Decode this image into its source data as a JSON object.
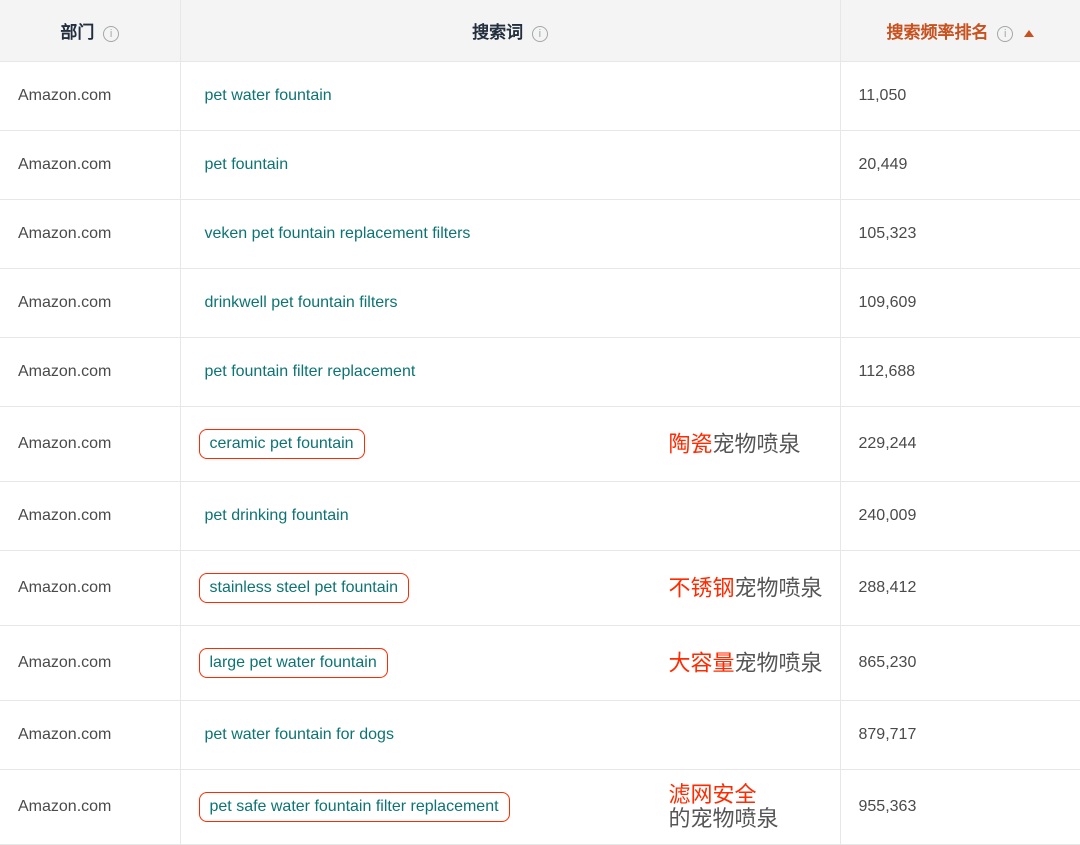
{
  "columns": {
    "department": "部门",
    "searchTerm": "搜索词",
    "rank": "搜索频率排名"
  },
  "rows": [
    {
      "dept": "Amazon.com",
      "term": "pet water fountain",
      "rank": "11,050",
      "highlight": false
    },
    {
      "dept": "Amazon.com",
      "term": "pet fountain",
      "rank": "20,449",
      "highlight": false
    },
    {
      "dept": "Amazon.com",
      "term": "veken pet fountain replacement filters",
      "rank": "105,323",
      "highlight": false
    },
    {
      "dept": "Amazon.com",
      "term": "drinkwell pet fountain filters",
      "rank": "109,609",
      "highlight": false
    },
    {
      "dept": "Amazon.com",
      "term": "pet fountain filter replacement",
      "rank": "112,688",
      "highlight": false
    },
    {
      "dept": "Amazon.com",
      "term": "ceramic pet fountain",
      "rank": "229,244",
      "highlight": true,
      "anno_em": "陶瓷",
      "anno_rest": "宠物喷泉"
    },
    {
      "dept": "Amazon.com",
      "term": "pet drinking fountain",
      "rank": "240,009",
      "highlight": false
    },
    {
      "dept": "Amazon.com",
      "term": "stainless steel pet fountain",
      "rank": "288,412",
      "highlight": true,
      "anno_em": "不锈钢",
      "anno_rest": "宠物喷泉"
    },
    {
      "dept": "Amazon.com",
      "term": "large pet water fountain",
      "rank": "865,230",
      "highlight": true,
      "anno_em": "大容量",
      "anno_rest": "宠物喷泉"
    },
    {
      "dept": "Amazon.com",
      "term": "pet water fountain for dogs",
      "rank": "879,717",
      "highlight": false
    },
    {
      "dept": "Amazon.com",
      "term": "pet safe water fountain filter replacement",
      "rank": "955,363",
      "highlight": true,
      "anno_em": "滤网安全",
      "anno_rest": "的宠物喷泉",
      "twoline": true
    }
  ]
}
